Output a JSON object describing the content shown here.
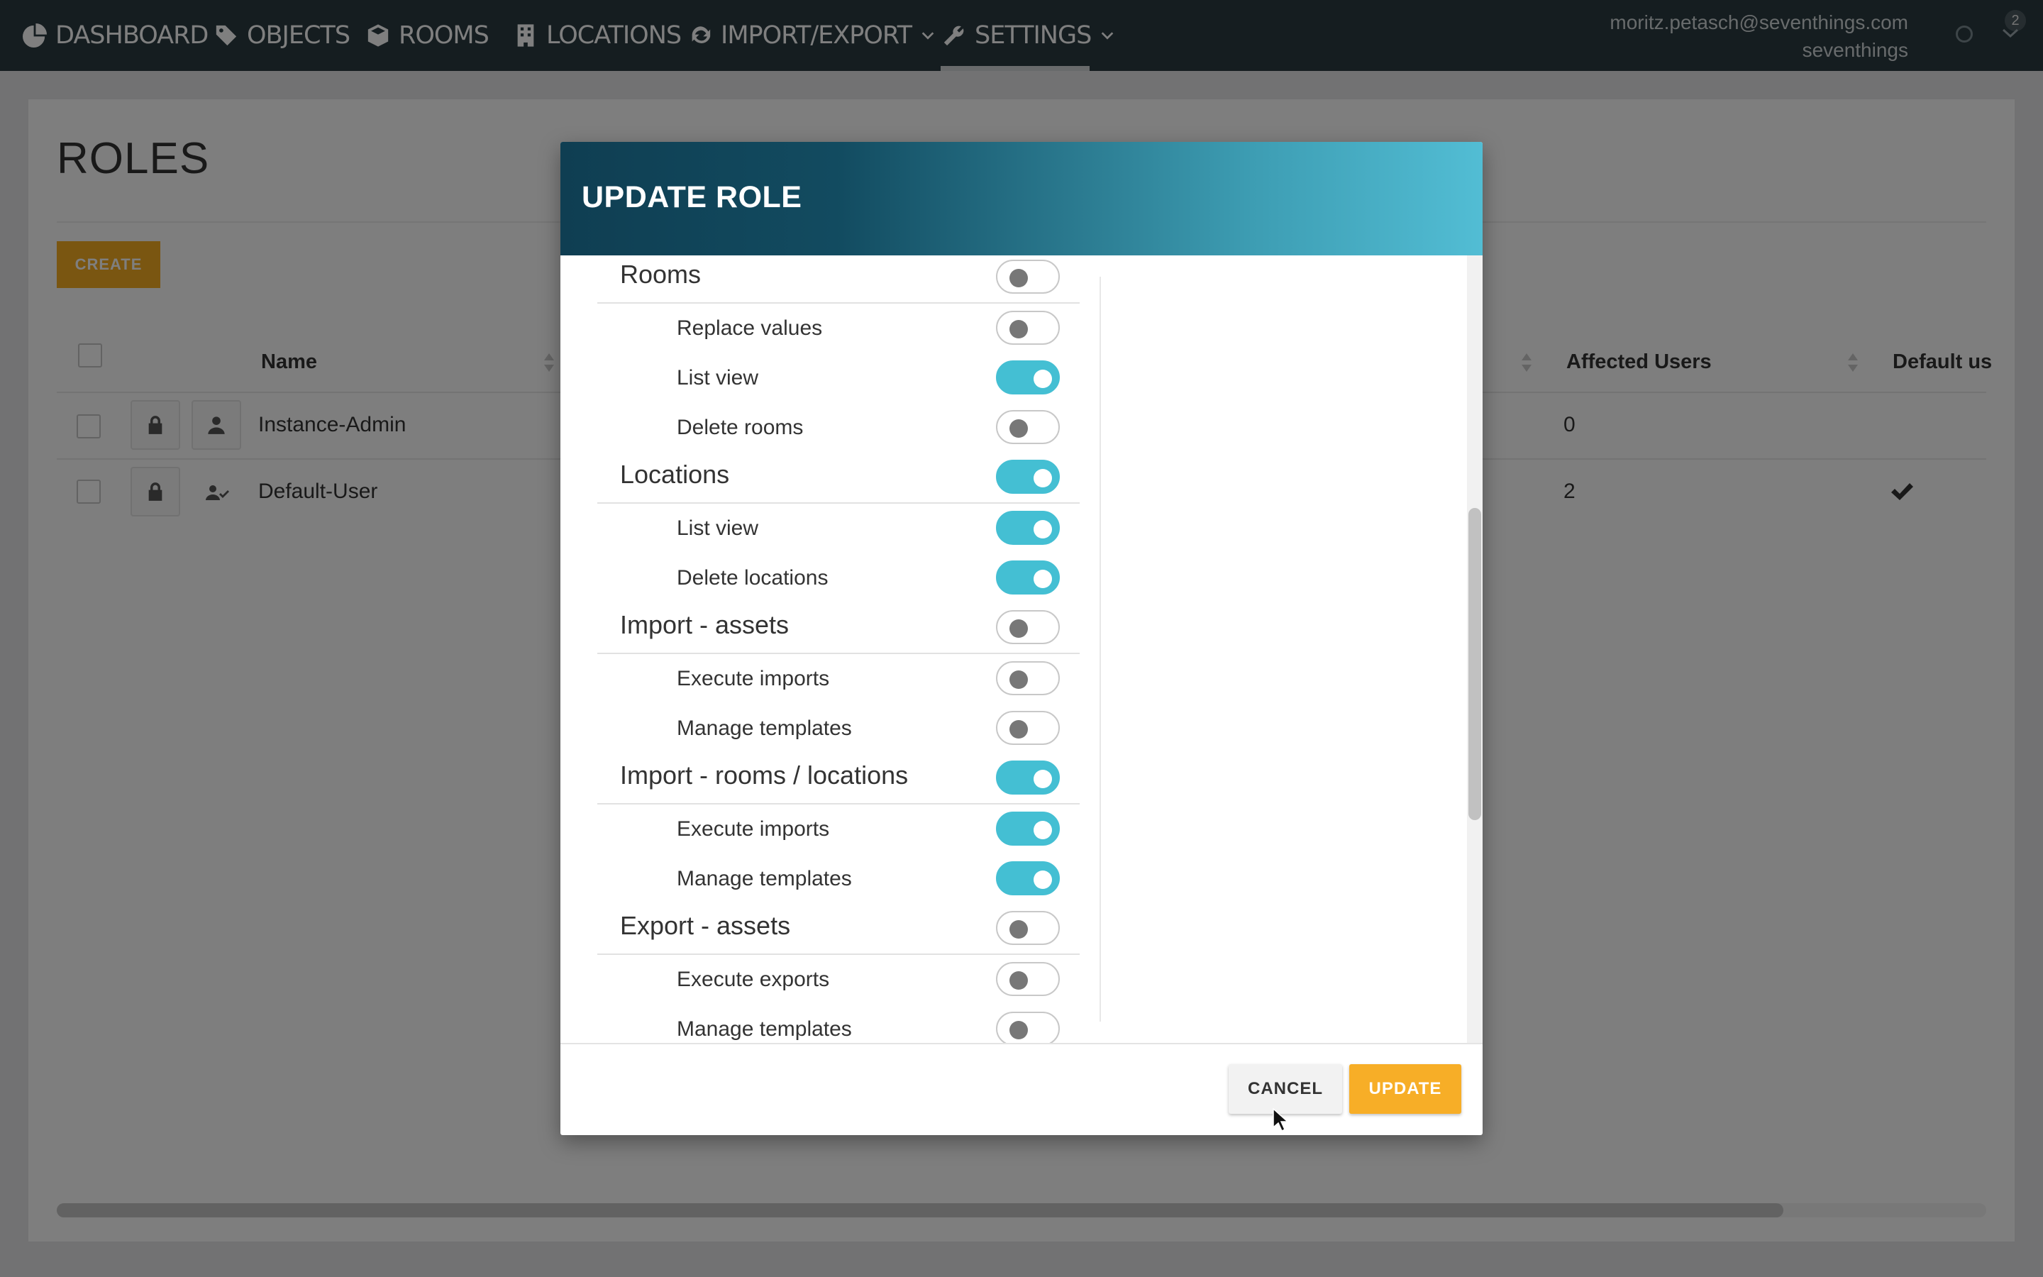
{
  "nav": {
    "items": [
      {
        "label": "DASHBOARD",
        "icon": "pie-chart-icon"
      },
      {
        "label": "OBJECTS",
        "icon": "tag-icon"
      },
      {
        "label": "ROOMS",
        "icon": "cube-icon"
      },
      {
        "label": "LOCATIONS",
        "icon": "building-icon"
      },
      {
        "label": "IMPORT/EXPORT",
        "icon": "refresh-icon",
        "dropdown": true
      },
      {
        "label": "SETTINGS",
        "icon": "wrench-icon",
        "dropdown": true,
        "active": true
      }
    ],
    "user_email": "moritz.petasch@seventhings.com",
    "user_org": "seventhings",
    "notification_count": "2"
  },
  "page": {
    "title": "ROLES",
    "create_label": "CREATE",
    "columns": {
      "name": "Name",
      "affected_users": "Affected Users",
      "default_user": "Default us"
    },
    "rows": [
      {
        "name": "Instance-Admin",
        "affected_users": "0",
        "is_default": false,
        "icon": "user-icon"
      },
      {
        "name": "Default-User",
        "affected_users": "2",
        "is_default": true,
        "icon": "user-check-icon"
      }
    ]
  },
  "modal": {
    "title": "UPDATE ROLE",
    "permissions": [
      {
        "label": "Rooms",
        "level": "category",
        "enabled": false
      },
      {
        "label": "Replace values",
        "level": "sub",
        "enabled": false
      },
      {
        "label": "List view",
        "level": "sub",
        "enabled": true
      },
      {
        "label": "Delete rooms",
        "level": "sub",
        "enabled": false
      },
      {
        "label": "Locations",
        "level": "category",
        "enabled": true
      },
      {
        "label": "List view",
        "level": "sub",
        "enabled": true
      },
      {
        "label": "Delete locations",
        "level": "sub",
        "enabled": true
      },
      {
        "label": "Import - assets",
        "level": "category",
        "enabled": false
      },
      {
        "label": "Execute imports",
        "level": "sub",
        "enabled": false
      },
      {
        "label": "Manage templates",
        "level": "sub",
        "enabled": false
      },
      {
        "label": "Import - rooms / locations",
        "level": "category",
        "enabled": true
      },
      {
        "label": "Execute imports",
        "level": "sub",
        "enabled": true
      },
      {
        "label": "Manage templates",
        "level": "sub",
        "enabled": true
      },
      {
        "label": "Export - assets",
        "level": "category",
        "enabled": false
      },
      {
        "label": "Execute exports",
        "level": "sub",
        "enabled": false
      },
      {
        "label": "Manage templates",
        "level": "sub",
        "enabled": false
      }
    ],
    "cancel_label": "CANCEL",
    "update_label": "UPDATE"
  },
  "colors": {
    "nav_bg": "#2a3a41",
    "accent_orange": "#f5ac22",
    "toggle_on": "#44bfd3",
    "header_gradient_start": "#0f3e52",
    "header_gradient_end": "#52bdd4"
  }
}
